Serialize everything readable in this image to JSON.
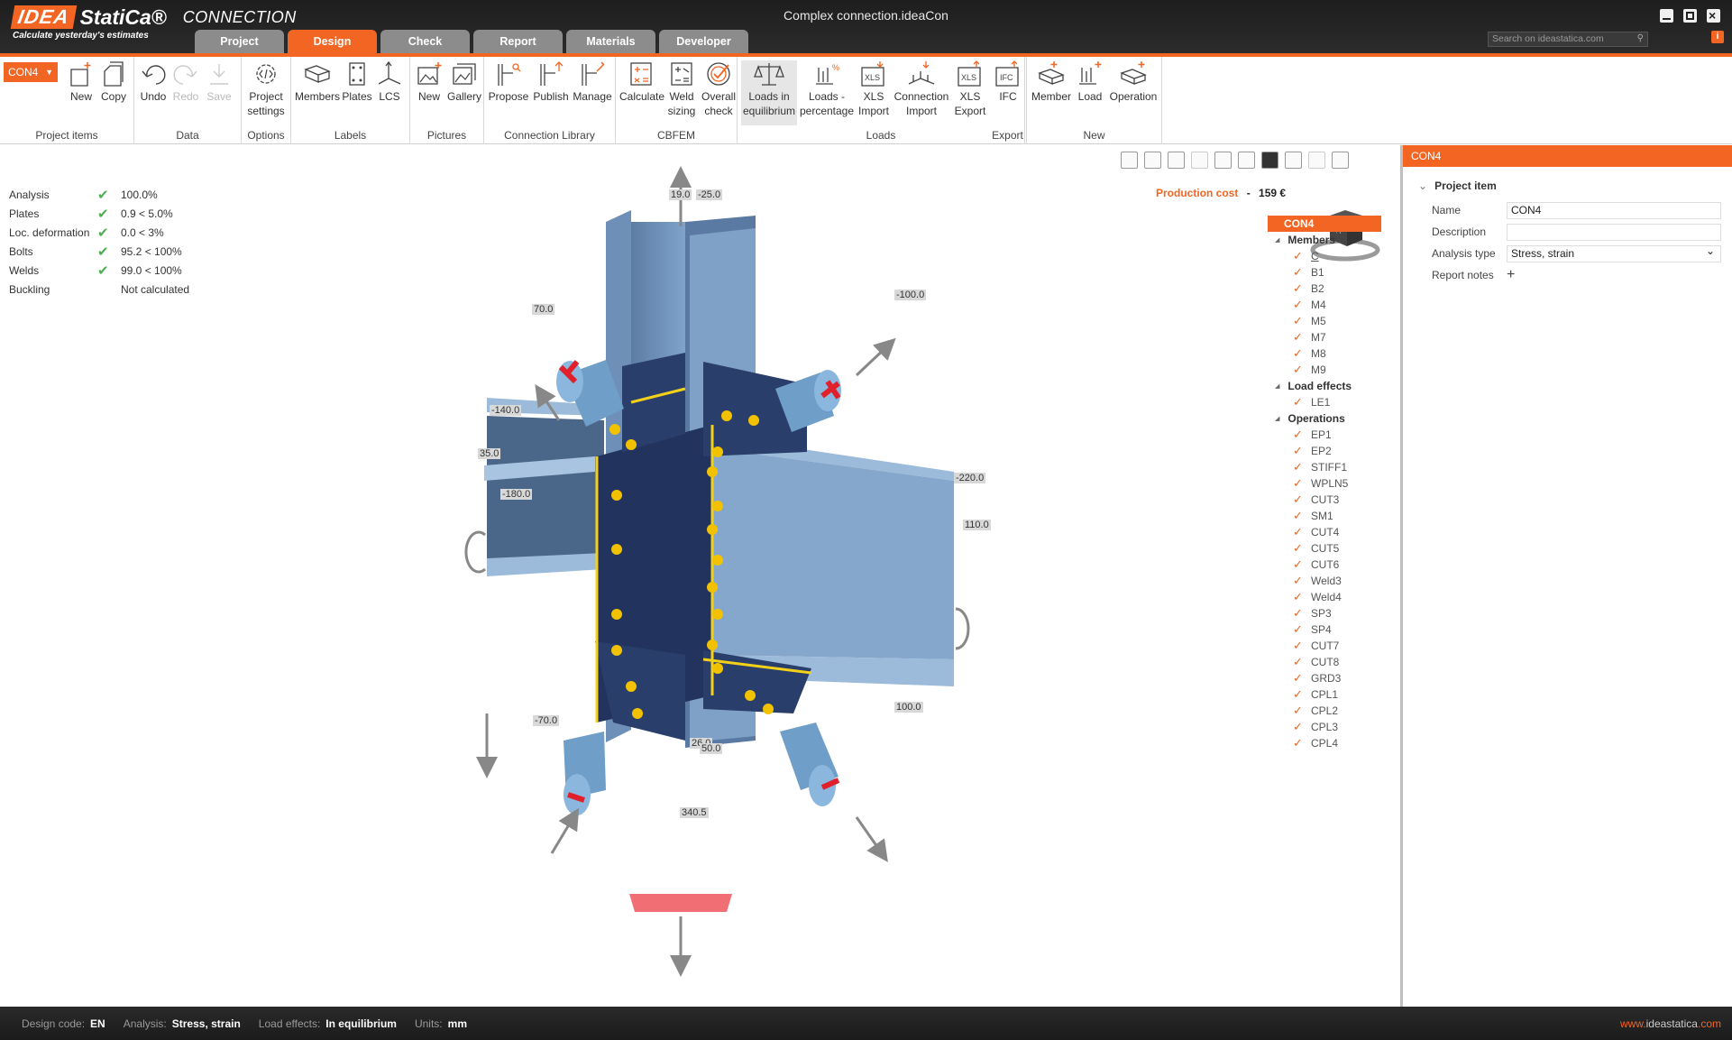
{
  "app": {
    "logo_idea": "IDEA",
    "logo_statica": "StatiCa®",
    "product": "CONNECTION",
    "slogan": "Calculate yesterday's estimates",
    "window_title": "Complex connection.ideaCon",
    "search_placeholder": "Search on ideastatica.com",
    "accent": "#f26522"
  },
  "tabs": [
    {
      "label": "Project"
    },
    {
      "label": "Design"
    },
    {
      "label": "Check"
    },
    {
      "label": "Report"
    },
    {
      "label": "Materials"
    },
    {
      "label": "Developer"
    }
  ],
  "ribbon": {
    "item_select": "CON4",
    "groups": {
      "project_items": "Project items",
      "data": "Data",
      "options": "Options",
      "labels": "Labels",
      "pictures": "Pictures",
      "connection_library": "Connection Library",
      "cbfem": "CBFEM",
      "loads": "Loads",
      "export": "Export",
      "new": "New"
    },
    "buttons": {
      "new": "New",
      "copy": "Copy",
      "undo": "Undo",
      "redo": "Redo",
      "save": "Save",
      "project_settings_1": "Project",
      "project_settings_2": "settings",
      "members": "Members",
      "plates": "Plates",
      "lcs": "LCS",
      "pic_new": "New",
      "gallery": "Gallery",
      "propose": "Propose",
      "publish": "Publish",
      "manage": "Manage",
      "calculate": "Calculate",
      "weld_1": "Weld",
      "weld_2": "sizing",
      "overall_1": "Overall",
      "overall_2": "check",
      "loads_eq_1": "Loads in",
      "loads_eq_2": "equilibrium",
      "loads_pct_1": "Loads -",
      "loads_pct_2": "percentage",
      "xls_import_1": "XLS",
      "xls_import_2": "Import",
      "conn_import_1": "Connection",
      "conn_import_2": "Import",
      "xls_export_1": "XLS",
      "xls_export_2": "Export",
      "ifc": "IFC",
      "member": "Member",
      "load": "Load",
      "operation": "Operation"
    }
  },
  "checks": [
    {
      "label": "Analysis",
      "ok": true,
      "value": "100.0%"
    },
    {
      "label": "Plates",
      "ok": true,
      "value": "0.9 < 5.0%"
    },
    {
      "label": "Loc. deformation",
      "ok": true,
      "value": "0.0 < 3%"
    },
    {
      "label": "Bolts",
      "ok": true,
      "value": "95.2 < 100%"
    },
    {
      "label": "Welds",
      "ok": true,
      "value": "99.0 < 100%"
    },
    {
      "label": "Buckling",
      "ok": false,
      "value": "Not calculated"
    }
  ],
  "production_cost": {
    "label": "Production cost",
    "sep": "-",
    "value": "159 €"
  },
  "navcube": {
    "face1": "+Y",
    "face2": "Z"
  },
  "loads": {
    "top1": "19.0",
    "top2": "-25.0",
    "ul": "70.0",
    "ur": "-100.0",
    "l1": "-140.0",
    "l2": "35.0",
    "l3": "-180.0",
    "r1": "-220.0",
    "r2": "110.0",
    "ll": "-70.0",
    "lr": "100.0",
    "b1": "26.0",
    "b2": "50.0",
    "b3": "340.5"
  },
  "tree": {
    "root": "CON4",
    "members_label": "Members",
    "members": [
      "C",
      "B1",
      "B2",
      "M4",
      "M5",
      "M7",
      "M8",
      "M9"
    ],
    "load_effects_label": "Load effects",
    "load_effects": [
      "LE1"
    ],
    "operations_label": "Operations",
    "operations": [
      "EP1",
      "EP2",
      "STIFF1",
      "WPLN5",
      "CUT3",
      "SM1",
      "CUT4",
      "CUT5",
      "CUT6",
      "Weld3",
      "Weld4",
      "SP3",
      "SP4",
      "CUT7",
      "CUT8",
      "GRD3",
      "CPL1",
      "CPL2",
      "CPL3",
      "CPL4"
    ]
  },
  "panel": {
    "header": "CON4",
    "section": "Project item",
    "name_label": "Name",
    "name_value": "CON4",
    "description_label": "Description",
    "description_value": "",
    "analysis_label": "Analysis type",
    "analysis_value": "Stress, strain",
    "notes_label": "Report notes",
    "notes_add": "+"
  },
  "status": {
    "design_code_label": "Design code:",
    "design_code": "EN",
    "analysis_label": "Analysis:",
    "analysis": "Stress, strain",
    "load_effects_label": "Load effects:",
    "load_effects": "In equilibrium",
    "units_label": "Units:",
    "units": "mm",
    "url_prefix": "www.",
    "url_main": "ideastatica",
    "url_suffix": ".com"
  }
}
